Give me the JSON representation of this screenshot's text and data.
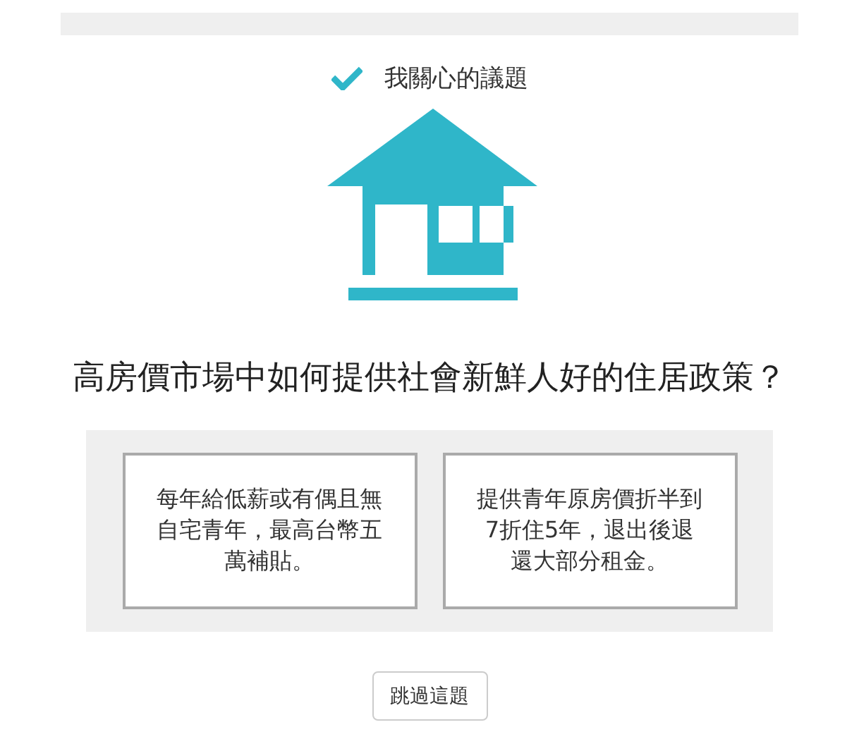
{
  "header": {
    "label": "我關心的議題"
  },
  "question": "高房價市場中如何提供社會新鮮人好的住居政策？",
  "options": [
    {
      "text": "每年給低薪或有偶且無自宅青年，最高台幣五萬補貼。"
    },
    {
      "text": "提供青年原房價折半到7折住5年，退出後退還大部分租金。"
    }
  ],
  "skip_button": "跳過這題"
}
